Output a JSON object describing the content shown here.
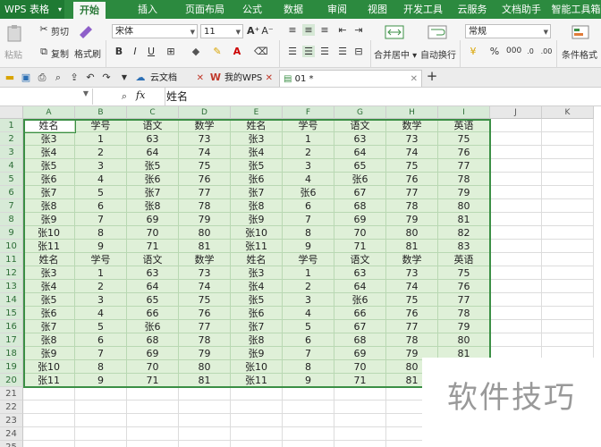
{
  "app": {
    "name": "WPS 表格"
  },
  "menu": {
    "tabs": [
      "开始",
      "插入",
      "页面布局",
      "公式",
      "数据",
      "审阅",
      "视图",
      "开发工具",
      "云服务",
      "文档助手",
      "智能工具箱"
    ],
    "active": "开始"
  },
  "ribbon": {
    "paste": "粘贴",
    "cut": "剪切",
    "copy": "复制",
    "format_painter": "格式刷",
    "font_name": "宋体",
    "font_size": "11",
    "merge_center": "合并居中",
    "wrap_text": "自动换行",
    "number_format": "常规",
    "conditional_format": "条件格式"
  },
  "doc_tabs": [
    {
      "label": "云文档"
    },
    {
      "label": "我的WPS"
    },
    {
      "label": "01 *"
    }
  ],
  "formula": {
    "fx": "fx",
    "content": "姓名"
  },
  "columns": [
    "A",
    "B",
    "C",
    "D",
    "E",
    "F",
    "G",
    "H",
    "I",
    "J",
    "K"
  ],
  "rows": [
    "1",
    "2",
    "3",
    "4",
    "5",
    "6",
    "7",
    "8",
    "9",
    "10",
    "11",
    "12",
    "13",
    "14",
    "15",
    "16",
    "17",
    "18",
    "19",
    "20",
    "21",
    "22",
    "23",
    "24",
    "25"
  ],
  "table": [
    [
      "姓名",
      "学号",
      "语文",
      "数学",
      "姓名",
      "学号",
      "语文",
      "数学",
      "英语"
    ],
    [
      "张3",
      "1",
      "63",
      "73",
      "张3",
      "1",
      "63",
      "73",
      "75"
    ],
    [
      "张4",
      "2",
      "64",
      "74",
      "张4",
      "2",
      "64",
      "74",
      "76"
    ],
    [
      "张5",
      "3",
      "张5",
      "75",
      "张5",
      "3",
      "65",
      "75",
      "77"
    ],
    [
      "张6",
      "4",
      "张6",
      "76",
      "张6",
      "4",
      "张6",
      "76",
      "78"
    ],
    [
      "张7",
      "5",
      "张7",
      "77",
      "张7",
      "张6",
      "67",
      "77",
      "79"
    ],
    [
      "张8",
      "6",
      "张8",
      "78",
      "张8",
      "6",
      "68",
      "78",
      "80"
    ],
    [
      "张9",
      "7",
      "69",
      "79",
      "张9",
      "7",
      "69",
      "79",
      "81"
    ],
    [
      "张10",
      "8",
      "70",
      "80",
      "张10",
      "8",
      "70",
      "80",
      "82"
    ],
    [
      "张11",
      "9",
      "71",
      "81",
      "张11",
      "9",
      "71",
      "81",
      "83"
    ],
    [
      "姓名",
      "学号",
      "语文",
      "数学",
      "姓名",
      "学号",
      "语文",
      "数学",
      "英语"
    ],
    [
      "张3",
      "1",
      "63",
      "73",
      "张3",
      "1",
      "63",
      "73",
      "75"
    ],
    [
      "张4",
      "2",
      "64",
      "74",
      "张4",
      "2",
      "64",
      "74",
      "76"
    ],
    [
      "张5",
      "3",
      "65",
      "75",
      "张5",
      "3",
      "张6",
      "75",
      "77"
    ],
    [
      "张6",
      "4",
      "66",
      "76",
      "张6",
      "4",
      "66",
      "76",
      "78"
    ],
    [
      "张7",
      "5",
      "张6",
      "77",
      "张7",
      "5",
      "67",
      "77",
      "79"
    ],
    [
      "张8",
      "6",
      "68",
      "78",
      "张8",
      "6",
      "68",
      "78",
      "80"
    ],
    [
      "张9",
      "7",
      "69",
      "79",
      "张9",
      "7",
      "69",
      "79",
      "81"
    ],
    [
      "张10",
      "8",
      "70",
      "80",
      "张10",
      "8",
      "70",
      "80",
      ""
    ],
    [
      "张11",
      "9",
      "71",
      "81",
      "张11",
      "9",
      "71",
      "81",
      ""
    ]
  ],
  "watermark": "软件技巧",
  "colors": {
    "accent": "#2c8a3f",
    "selection": "#dff0d8",
    "selection_border": "#3b8f45"
  }
}
